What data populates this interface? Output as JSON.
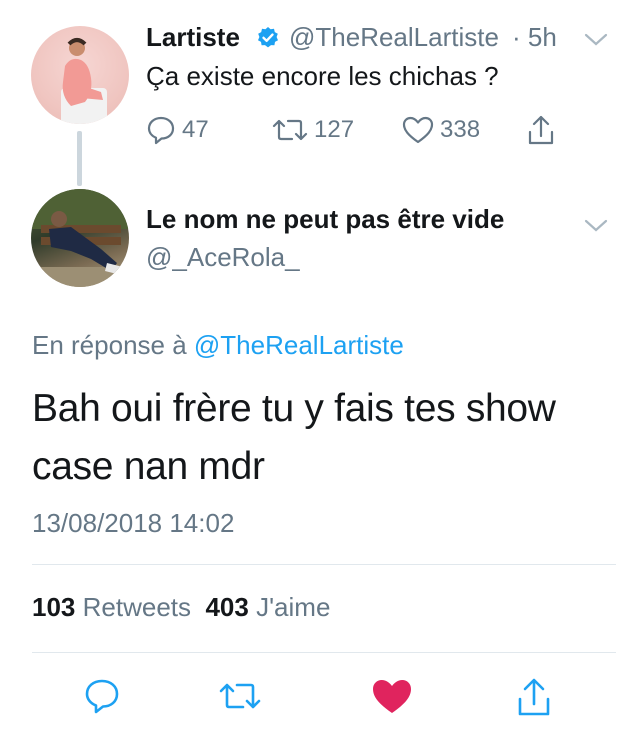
{
  "parent_tweet": {
    "name": "Lartiste",
    "handle": "@TheRealLartiste",
    "time": "· 5h",
    "text": "Ça existe encore les chichas ?",
    "replies": "47",
    "retweets": "127",
    "likes": "338"
  },
  "reply_tweet": {
    "name": "Le nom ne peut pas être vide",
    "handle": "@_AceRola_",
    "in_reply_prefix": "En réponse à",
    "in_reply_handle": "@TheRealLartiste",
    "text": "Bah oui frère tu y fais tes show case  nan mdr",
    "timestamp": "13/08/2018 14:02",
    "retweet_count": "103",
    "retweet_label": "Retweets",
    "like_count": "403",
    "like_label": "J'aime"
  },
  "colors": {
    "accent": "#1da1f2",
    "muted": "#657786",
    "like_active": "#e0245e",
    "divider": "#e1e8ed"
  },
  "icons": [
    "verified-badge-icon",
    "chevron-down-icon",
    "reply-icon",
    "retweet-icon",
    "like-icon",
    "share-icon"
  ]
}
